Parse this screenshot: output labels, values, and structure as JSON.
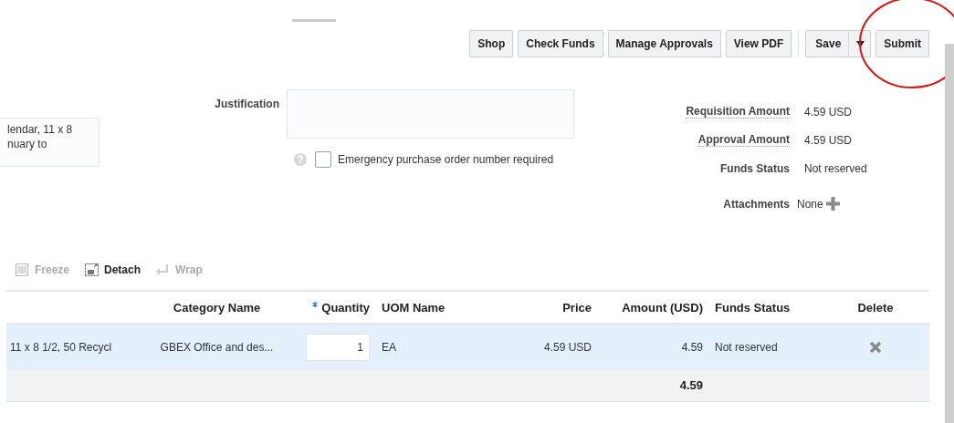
{
  "toolbar": {
    "buttons": [
      {
        "label": "Shop",
        "kind": "button",
        "highlighted": false
      },
      {
        "label": "Check Funds",
        "kind": "button",
        "highlighted": false
      },
      {
        "label": "Manage Approvals",
        "kind": "button",
        "highlighted": false
      },
      {
        "label": "View PDF",
        "kind": "button",
        "highlighted": false
      },
      {
        "label": "Save",
        "kind": "split",
        "highlighted": false
      },
      {
        "label": "Submit",
        "kind": "button",
        "highlighted": true
      }
    ]
  },
  "description_field": {
    "value": "lendar, 11 x 8\nnuary to"
  },
  "justification": {
    "label": "Justification"
  },
  "emergency": {
    "label": "Emergency purchase order number required",
    "checked": false
  },
  "summary": [
    {
      "label": "Requisition Amount",
      "value": "4.59  USD",
      "link": true
    },
    {
      "label": "Approval Amount",
      "value": "4.59  USD",
      "link": true
    },
    {
      "label": "Funds Status",
      "value": "Not reserved",
      "link": false
    }
  ],
  "attachments": {
    "label": "Attachments",
    "value": "None"
  },
  "table_toolbar": [
    {
      "label": "Freeze",
      "disabled": true
    },
    {
      "label": "Detach",
      "disabled": false
    },
    {
      "label": "Wrap",
      "disabled": true
    }
  ],
  "table": {
    "columns": [
      {
        "required": false
      },
      {
        "label": "Category Name",
        "required": false
      },
      {
        "label": "Quantity",
        "required": true
      },
      {
        "label": "UOM Name",
        "required": false
      },
      {
        "label": "Price",
        "required": false
      },
      {
        "label": "Amount (USD)",
        "required": false
      },
      {
        "label": "Funds Status",
        "required": false
      },
      {
        "label": "Delete",
        "required": false
      }
    ],
    "rows": [
      {
        "selected": true,
        "cells": [
          "11 x 8 1/2, 50 Recycl",
          "GBEX Office and des...",
          "1",
          "EA",
          "4.59 USD",
          "4.59",
          "Not reserved",
          ""
        ]
      }
    ],
    "totals": {
      "amount": "4.59"
    }
  }
}
